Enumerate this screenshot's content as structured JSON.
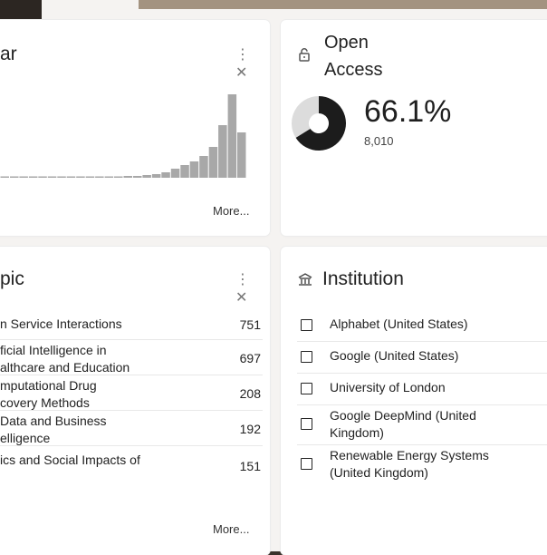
{
  "year_card": {
    "title_visible": "ar",
    "controls": "⋮ ✕",
    "more_label": "More...",
    "chart_data": {
      "type": "bar",
      "values": [
        1,
        1,
        1,
        1,
        1,
        1,
        1,
        1,
        1,
        1,
        1,
        1,
        1,
        2,
        2,
        3,
        4,
        6,
        10,
        14,
        18,
        24,
        34,
        58,
        92,
        50
      ]
    }
  },
  "open_access_card": {
    "title_line1": "Open",
    "title_line2": "Access",
    "percent": "66.1%",
    "count": "8,010",
    "fraction_open": 0.661,
    "colors": {
      "open": "#1c1c1c",
      "closed": "#dcdcdc"
    },
    "icon": "unlock-icon"
  },
  "topic_card": {
    "title_visible": "pic",
    "controls": "⋮ ✕",
    "more_label": "More...",
    "rows": [
      {
        "lines": [
          "n Service Interactions"
        ],
        "count": "751"
      },
      {
        "lines": [
          "ficial Intelligence in",
          "althcare and Education"
        ],
        "count": "697"
      },
      {
        "lines": [
          "mputational Drug",
          "covery Methods"
        ],
        "count": "208"
      },
      {
        "lines": [
          "Data and Business",
          "elligence"
        ],
        "count": "192"
      },
      {
        "lines": [
          "ics and Social Impacts of"
        ],
        "count": "151"
      }
    ]
  },
  "institution_card": {
    "title": "Institution",
    "icon": "institution-icon",
    "rows": [
      {
        "lines": [
          "Alphabet (United States)"
        ]
      },
      {
        "lines": [
          "Google (United States)"
        ]
      },
      {
        "lines": [
          "University of London"
        ]
      },
      {
        "lines": [
          "Google DeepMind (United",
          "Kingdom)"
        ]
      },
      {
        "lines": [
          "Renewable Energy Systems",
          "(United Kingdom)"
        ]
      }
    ]
  }
}
